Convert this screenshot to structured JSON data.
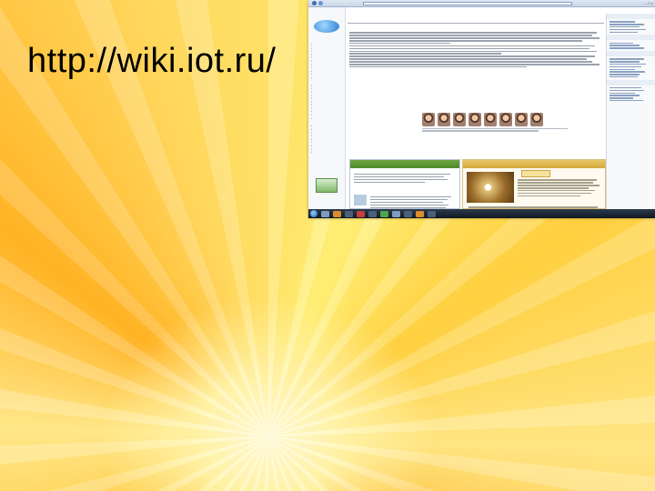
{
  "slide": {
    "title": "http://wiki.iot.ru/"
  },
  "browser": {
    "url": "",
    "tabs": [
      "",
      "",
      "",
      ""
    ]
  },
  "wiki": {
    "logo_text": "",
    "page_heading": "",
    "welcome_title": "",
    "left_column_title": "",
    "right_column_title": "",
    "news_badge": ""
  },
  "colors": {
    "slide_background": "#ffd24a",
    "left_band": "#5e982f",
    "right_band": "#dfb552"
  },
  "icons": {
    "start": "windows-start-icon",
    "back": "back-arrow-icon",
    "forward": "forward-arrow-icon"
  }
}
